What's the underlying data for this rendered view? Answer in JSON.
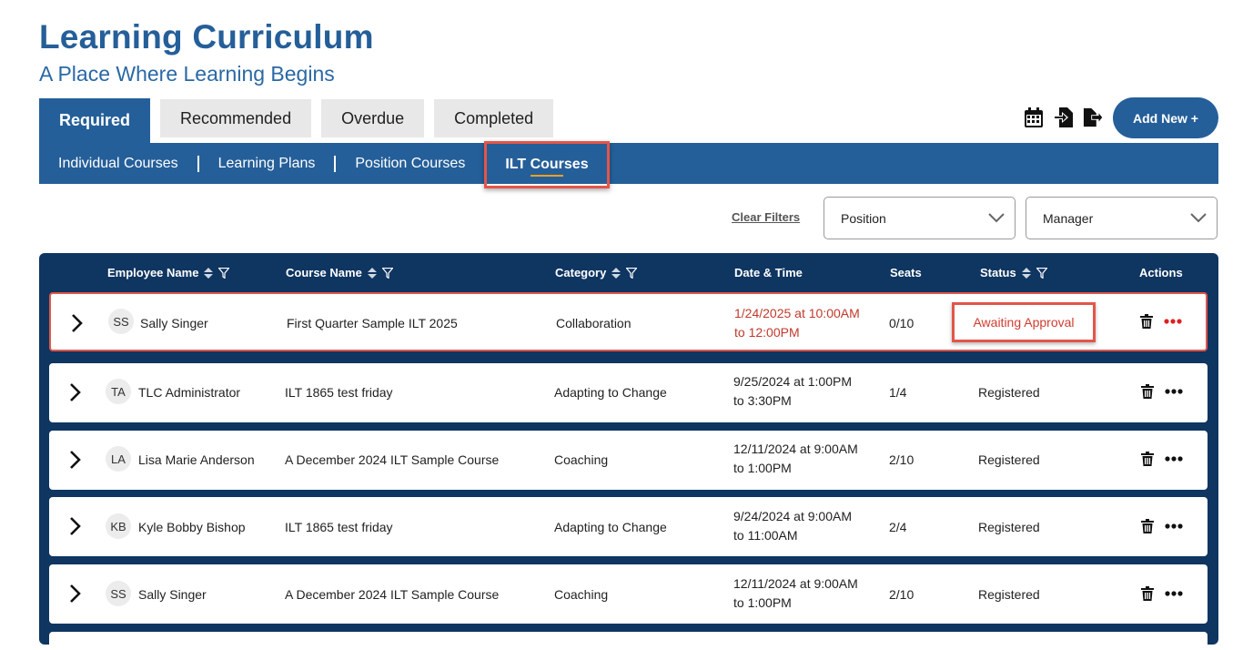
{
  "header": {
    "title": "Learning Curriculum",
    "subtitle": "A Place Where Learning Begins"
  },
  "tabs": [
    {
      "label": "Required",
      "active": true
    },
    {
      "label": "Recommended",
      "active": false
    },
    {
      "label": "Overdue",
      "active": false
    },
    {
      "label": "Completed",
      "active": false
    }
  ],
  "toolbar": {
    "icons": [
      "calendar-icon",
      "import-icon",
      "export-icon"
    ],
    "add_new_label": "Add New +"
  },
  "subnav": [
    {
      "label": "Individual Courses",
      "active": false
    },
    {
      "label": "Learning Plans",
      "active": false
    },
    {
      "label": "Position Courses",
      "active": false
    },
    {
      "label": "ILT Courses",
      "active": true
    }
  ],
  "filters": {
    "clear_label": "Clear Filters",
    "position_value": "Position",
    "manager_value": "Manager"
  },
  "table": {
    "columns": {
      "employee": "Employee Name",
      "course": "Course Name",
      "category": "Category",
      "datetime": "Date & Time",
      "seats": "Seats",
      "status": "Status",
      "actions": "Actions"
    },
    "rows": [
      {
        "initials": "SS",
        "employee": "Sally Singer",
        "course": "First Quarter Sample ILT 2025",
        "category": "Collaboration",
        "date_line1": "1/24/2025 at 10:00AM",
        "date_line2": "to 12:00PM",
        "seats": "0/10",
        "status": "Awaiting Approval"
      },
      {
        "initials": "TA",
        "employee": "TLC Administrator",
        "course": "ILT 1865 test friday",
        "category": "Adapting to Change",
        "date_line1": "9/25/2024 at 1:00PM",
        "date_line2": "to 3:30PM",
        "seats": "1/4",
        "status": "Registered"
      },
      {
        "initials": "LA",
        "employee": "Lisa Marie Anderson",
        "course": "A December 2024 ILT Sample Course",
        "category": "Coaching",
        "date_line1": "12/11/2024 at 9:00AM",
        "date_line2": "to 1:00PM",
        "seats": "2/10",
        "status": "Registered"
      },
      {
        "initials": "KB",
        "employee": "Kyle Bobby Bishop",
        "course": "ILT 1865 test friday",
        "category": "Adapting to Change",
        "date_line1": "9/24/2024 at 9:00AM",
        "date_line2": "to 11:00AM",
        "seats": "2/4",
        "status": "Registered"
      },
      {
        "initials": "SS",
        "employee": "Sally Singer",
        "course": "A December 2024 ILT Sample Course",
        "category": "Coaching",
        "date_line1": "12/11/2024 at 9:00AM",
        "date_line2": "to 1:00PM",
        "seats": "2/10",
        "status": "Registered"
      }
    ]
  },
  "colors": {
    "brand_blue": "#255f99",
    "table_navy": "#0f3561",
    "highlight_red": "#e2564a",
    "status_red": "#d13c2f"
  }
}
